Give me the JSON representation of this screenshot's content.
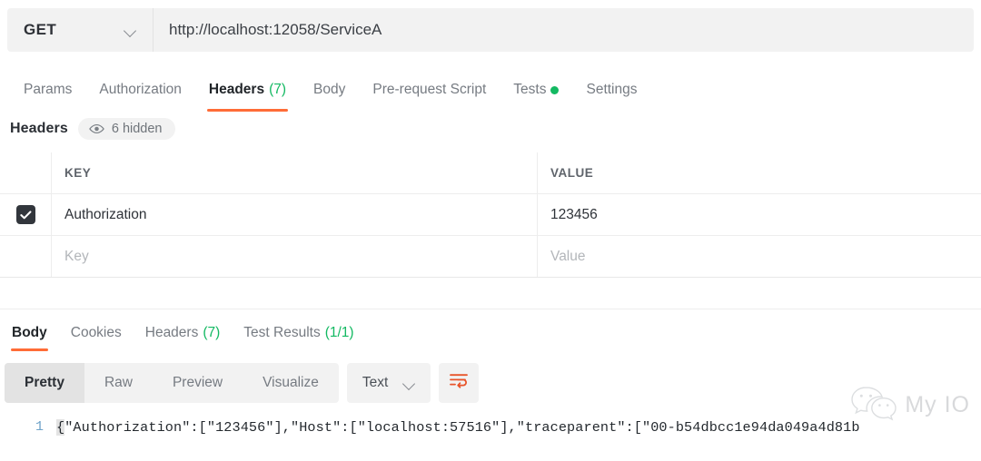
{
  "request": {
    "method": "GET",
    "url": "http://localhost:12058/ServiceA",
    "method_icon": "chevron-down-icon",
    "tabs": [
      {
        "label": "Params",
        "count": "",
        "active": false
      },
      {
        "label": "Authorization",
        "count": "",
        "active": false
      },
      {
        "label": "Headers",
        "count": "(7)",
        "active": true
      },
      {
        "label": "Body",
        "count": "",
        "active": false
      },
      {
        "label": "Pre-request Script",
        "count": "",
        "active": false
      },
      {
        "label": "Tests",
        "count": "",
        "active": false,
        "dot": true
      },
      {
        "label": "Settings",
        "count": "",
        "active": false
      }
    ]
  },
  "headers_section": {
    "title": "Headers",
    "hidden_pill": {
      "icon": "eye-icon",
      "label": "6 hidden"
    },
    "columns": [
      "KEY",
      "VALUE"
    ],
    "rows": [
      {
        "checked": true,
        "key": "Authorization",
        "value": "123456"
      }
    ],
    "new_row": {
      "key_placeholder": "Key",
      "value_placeholder": "Value"
    }
  },
  "response": {
    "tabs": [
      {
        "label": "Body",
        "count": "",
        "active": true
      },
      {
        "label": "Cookies",
        "count": "",
        "active": false
      },
      {
        "label": "Headers",
        "count": "(7)",
        "active": false
      },
      {
        "label": "Test Results",
        "count": "(1/1)",
        "active": false
      }
    ],
    "format_tabs": [
      {
        "label": "Pretty",
        "active": true
      },
      {
        "label": "Raw",
        "active": false
      },
      {
        "label": "Preview",
        "active": false
      },
      {
        "label": "Visualize",
        "active": false
      }
    ],
    "type_select": {
      "value": "Text",
      "icon": "chevron-down-icon"
    },
    "wrap_button": {
      "icon": "word-wrap-icon"
    },
    "body": {
      "line_number": "1",
      "brace": "{",
      "content": "\"Authorization\":[\"123456\"],\"Host\":[\"localhost:57516\"],\"traceparent\":[\"00-b54dbcc1e94da049a4d81b"
    }
  },
  "watermark": {
    "icon": "wechat-icon",
    "text": "My IO"
  },
  "colors": {
    "accent_orange": "#ff6c37",
    "status_green": "#13b962",
    "toolbar_gray": "#f2f2f2",
    "text_primary": "#2b2f35",
    "text_muted": "#767b82",
    "line_number_blue": "#6fa3c9"
  }
}
